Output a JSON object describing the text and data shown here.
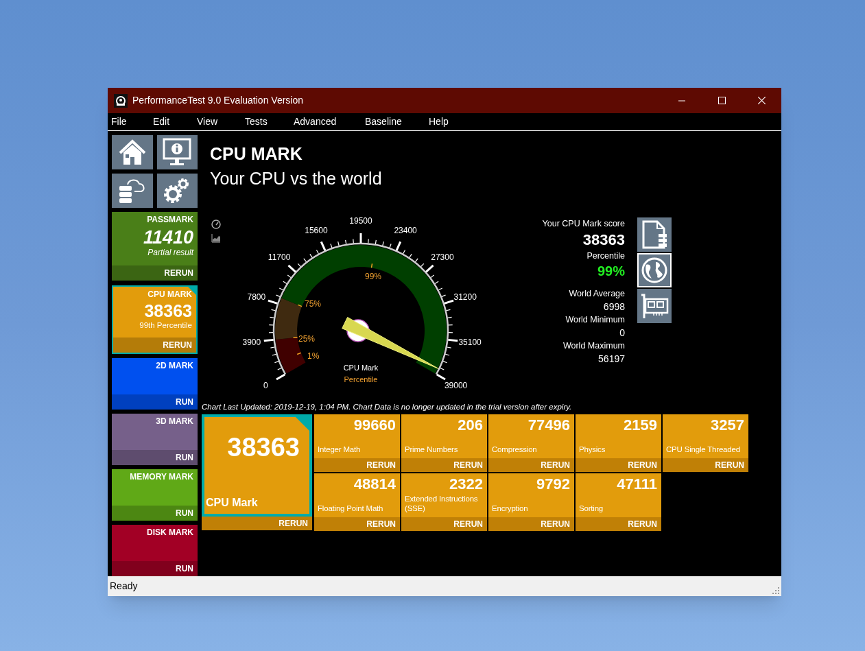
{
  "window": {
    "title": "PerformanceTest 9.0 Evaluation Version"
  },
  "menu": [
    "File",
    "Edit",
    "View",
    "Tests",
    "Advanced",
    "Baseline",
    "Help"
  ],
  "sidebar": {
    "tiles": [
      {
        "kind": "partial",
        "title": "PASSMARK",
        "score": "11410",
        "note": "Partial result",
        "action": "RERUN",
        "selected": false,
        "color": "#4a7f18"
      },
      {
        "kind": "scored",
        "title": "CPU MARK",
        "score": "38363",
        "note": "99th Percentile",
        "action": "RERUN",
        "selected": true,
        "color": "#e29c0c"
      },
      {
        "kind": "empty",
        "title": "2D MARK",
        "action": "RUN",
        "selected": false,
        "color": "#0050ef"
      },
      {
        "kind": "empty",
        "title": "3D MARK",
        "action": "RUN",
        "selected": false,
        "color": "#76608a"
      },
      {
        "kind": "empty",
        "title": "MEMORY MARK",
        "action": "RUN",
        "selected": false,
        "color": "#60a917"
      },
      {
        "kind": "empty",
        "title": "DISK MARK",
        "action": "RUN",
        "selected": false,
        "color": "#a20025"
      }
    ]
  },
  "main": {
    "heading": "CPU MARK",
    "subheading": "Your CPU vs the world",
    "gauge": {
      "tick_labels": [
        "0",
        "3900",
        "7800",
        "11700",
        "15600",
        "19500",
        "23400",
        "27300",
        "31200",
        "35100",
        "39000"
      ],
      "band_labels": [
        "99%",
        "75%",
        "25%",
        "1%"
      ],
      "caption": "CPU Mark",
      "sub_caption": "Percentile"
    },
    "score_panel": [
      {
        "kind": "label",
        "text": "Your CPU Mark score"
      },
      {
        "kind": "big",
        "text": "38363"
      },
      {
        "kind": "label",
        "text": "Percentile"
      },
      {
        "kind": "highlight",
        "text": "99%"
      },
      {
        "kind": "label",
        "text": "World Average"
      },
      {
        "kind": "value",
        "text": "6998"
      },
      {
        "kind": "label",
        "text": "World Minimum"
      },
      {
        "kind": "value",
        "text": "0"
      },
      {
        "kind": "label",
        "text": "World Maximum"
      },
      {
        "kind": "value",
        "text": "56197"
      }
    ],
    "view_buttons": [
      {
        "kind": "document",
        "selected": false
      },
      {
        "kind": "globe",
        "selected": true
      },
      {
        "kind": "card",
        "selected": false
      }
    ],
    "chart_note": "Chart Last Updated: 2019-12-19, 1:04 PM. Chart Data is no longer updated in the trial version after expiry.",
    "overall": {
      "score": "38363",
      "label": "CPU Mark",
      "action": "RERUN",
      "selected": true
    },
    "tests": [
      {
        "score": "99660",
        "label": "Integer Math",
        "action": "RERUN"
      },
      {
        "score": "206",
        "label": "Prime Numbers",
        "action": "RERUN"
      },
      {
        "score": "77496",
        "label": "Compression",
        "action": "RERUN"
      },
      {
        "score": "2159",
        "label": "Physics",
        "action": "RERUN"
      },
      {
        "score": "3257",
        "label": "CPU Single Threaded",
        "action": "RERUN"
      },
      {
        "score": "48814",
        "label": "Floating Point Math",
        "action": "RERUN"
      },
      {
        "score": "2322",
        "label": "Extended Instructions (SSE)",
        "action": "RERUN"
      },
      {
        "score": "9792",
        "label": "Encryption",
        "action": "RERUN"
      },
      {
        "score": "47111",
        "label": "Sorting",
        "action": "RERUN"
      }
    ]
  },
  "status_bar": "Ready"
}
